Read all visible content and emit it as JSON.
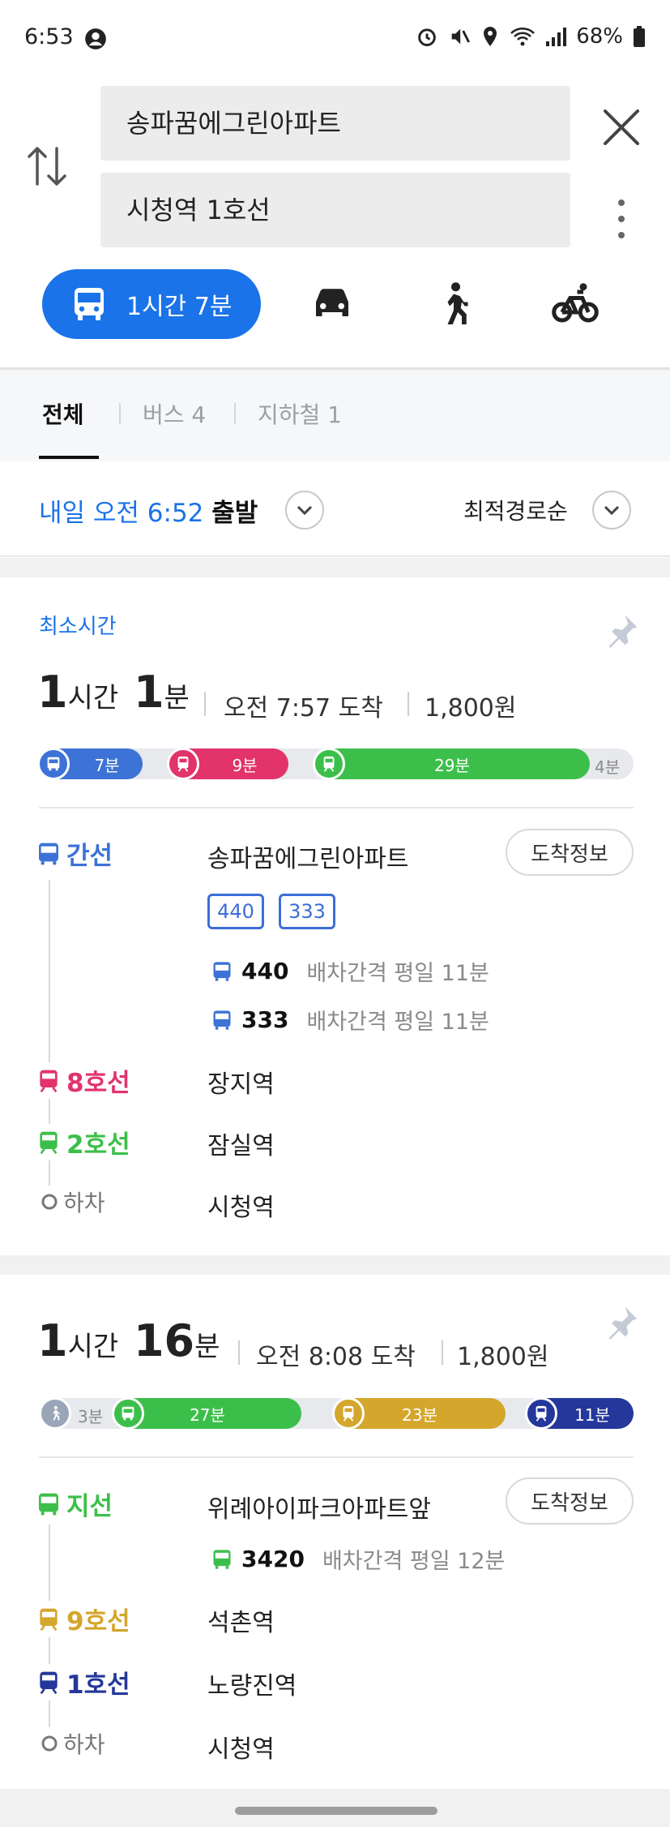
{
  "status_bar": {
    "time": "6:53",
    "battery": "68%"
  },
  "search": {
    "origin": "송파꿈에그린아파트",
    "destination": "시청역 1호선"
  },
  "modes": {
    "transit_duration": "1시간 7분"
  },
  "tabs": [
    {
      "label": "전체"
    },
    {
      "label": "버스 4"
    },
    {
      "label": "지하철 1"
    }
  ],
  "departure": {
    "day_time": "내일 오전 6:52",
    "suffix": "출발"
  },
  "sort": {
    "label": "최적경로순"
  },
  "routes": [
    {
      "tag": "최소시간",
      "duration_h": "1",
      "duration_h_unit": "시간",
      "duration_m": "1",
      "duration_m_unit": "분",
      "arrival": "오전 7:57 도착",
      "fare": "1,800원",
      "segments": [
        {
          "label": "7분",
          "color": "#3d73d6"
        },
        {
          "label": "9분",
          "color": "#e2336b"
        },
        {
          "label": "29분",
          "color": "#3cbf4a"
        },
        {
          "label": "4분",
          "color": "#e7e9ed"
        }
      ],
      "legs": [
        {
          "line": "간선",
          "color": "#3d73d6",
          "stop": "송파꿈에그린아파트",
          "arrival_info": "도착정보",
          "chips": [
            "440",
            "333"
          ],
          "buses": [
            {
              "number": "440",
              "interval": "배차간격 평일 11분"
            },
            {
              "number": "333",
              "interval": "배차간격 평일 11분"
            }
          ]
        },
        {
          "line": "8호선",
          "color": "#e2336b",
          "stop": "장지역"
        },
        {
          "line": "2호선",
          "color": "#3cbf4a",
          "stop": "잠실역"
        },
        {
          "line": "하차",
          "color": "#777777",
          "stop": "시청역"
        }
      ]
    },
    {
      "duration_h": "1",
      "duration_h_unit": "시간",
      "duration_m": "16",
      "duration_m_unit": "분",
      "arrival": "오전 8:08 도착",
      "fare": "1,800원",
      "segments": [
        {
          "label": "3분",
          "color": "#9aa6b8"
        },
        {
          "label": "27분",
          "color": "#3cbf4a"
        },
        {
          "label": "23분",
          "color": "#d4a62c"
        },
        {
          "label": "11분",
          "color": "#24379a"
        }
      ],
      "legs": [
        {
          "line": "지선",
          "color": "#3cbf4a",
          "stop": "위례아이파크아파트앞",
          "arrival_info": "도착정보",
          "buses": [
            {
              "number": "3420",
              "interval": "배차간격 평일 12분"
            }
          ]
        },
        {
          "line": "9호선",
          "color": "#d4a62c",
          "stop": "석촌역"
        },
        {
          "line": "1호선",
          "color": "#24379a",
          "stop": "노량진역"
        },
        {
          "line": "하차",
          "color": "#777777",
          "stop": "시청역"
        }
      ]
    }
  ]
}
